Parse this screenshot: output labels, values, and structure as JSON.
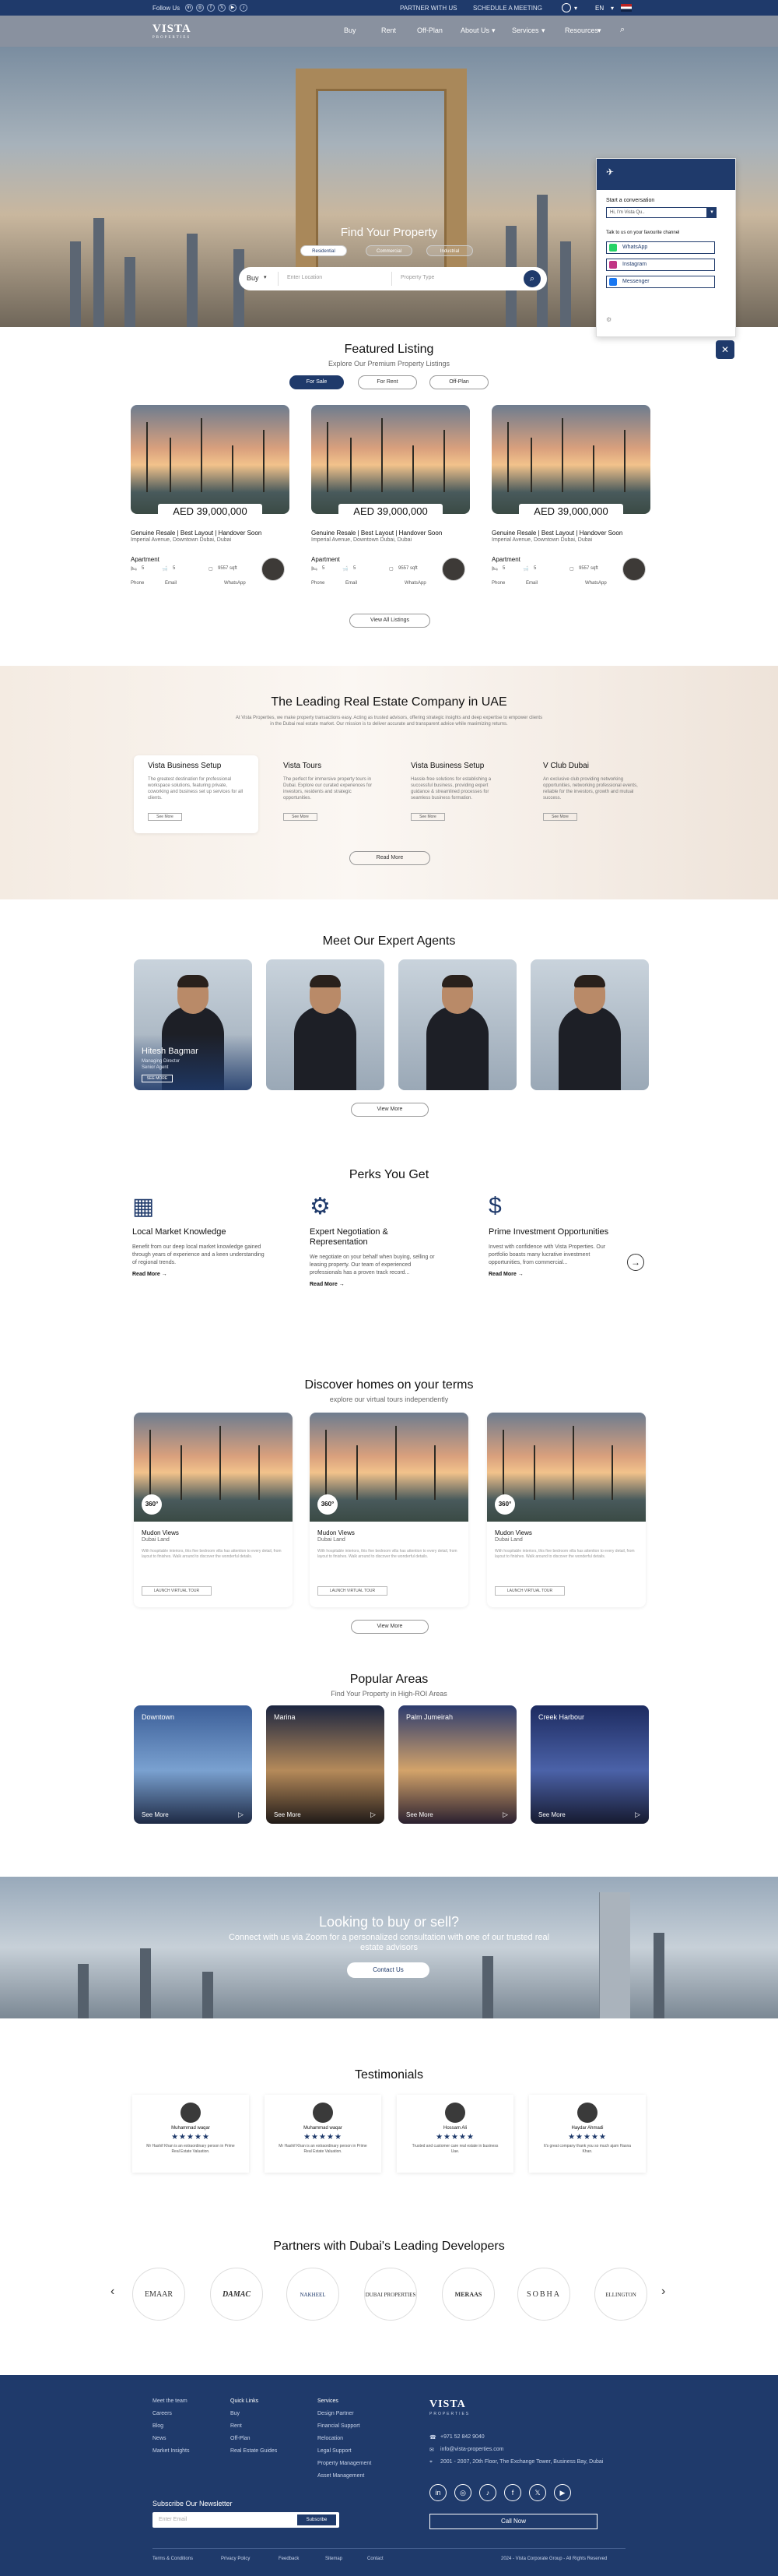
{
  "topbar": {
    "follow": "Follow Us",
    "social": [
      "in",
      "◎",
      "f",
      "𝕏",
      "▶",
      "♪"
    ],
    "partner": "PARTNER WITH US",
    "schedule": "SCHEDULE A MEETING",
    "lang": "EN"
  },
  "nav": {
    "logo": "VISTA",
    "logo_sub": "PROPERTIES",
    "items": [
      "Buy",
      "Rent",
      "Off-Plan",
      "About Us",
      "Services",
      "Resources"
    ]
  },
  "hero": {
    "title": "Find Your Property",
    "tabs": [
      "Residential",
      "Commercial",
      "Industrial"
    ],
    "search": {
      "mode": "Buy",
      "location_placeholder": "Enter Location",
      "type_placeholder": "Property Type"
    }
  },
  "chat": {
    "title": "Start a conversation",
    "select": "Hi, I'm Vista Qu..",
    "prompt": "Talk to us on your favourite channel",
    "channels": [
      "WhatsApp",
      "Instagram",
      "Messenger"
    ]
  },
  "featured": {
    "title": "Featured Listing",
    "subtitle": "Explore Our Premium Property Listings",
    "tabs": [
      "For Sale",
      "For Rent",
      "Off-Plan"
    ],
    "cards": [
      {
        "price": "AED 39,000,000",
        "title": "Genuine Resale | Best Layout | Handover Soon",
        "address": "Imperial Avenue, Downtown Dubai, Dubai",
        "kind": "Apartment",
        "beds": "5",
        "baths": "5",
        "area": "9557 sqft"
      },
      {
        "price": "AED 39,000,000",
        "title": "Genuine Resale | Best Layout | Handover Soon",
        "address": "Imperial Avenue, Downtown Dubai, Dubai",
        "kind": "Apartment",
        "beds": "5",
        "baths": "5",
        "area": "9557 sqft"
      },
      {
        "price": "AED 39,000,000",
        "title": "Genuine Resale | Best Layout | Handover Soon",
        "address": "Imperial Avenue, Downtown Dubai, Dubai",
        "kind": "Apartment",
        "beds": "5",
        "baths": "5",
        "area": "9557 sqft"
      }
    ],
    "contacts": [
      "Phone",
      "Email",
      "WhatsApp"
    ],
    "view_all": "View All Listings"
  },
  "about": {
    "title": "The Leading Real Estate Company in UAE",
    "intro": "At Vista Properties, we make property transactions easy. Acting as trusted advisors, offering strategic insights and deep expertise to empower clients in the Dubai real estate market. Our mission is to deliver accurate and transparent advice while maximizing returns.",
    "boxes": [
      {
        "title": "Vista Business Setup",
        "text": "The greatest destination for professional workspace solutions, featuring private, coworking and business set up services for all clients.",
        "btn": "See More"
      },
      {
        "title": "Vista Tours",
        "text": "The perfect for immersive property tours in Dubai. Explore our curated experiences for investors, residents and strategic opportunities.",
        "btn": "See More"
      },
      {
        "title": "Vista Business Setup",
        "text": "Hassle-free solutions for establishing a successful business, providing expert guidance & streamlined processes for seamless business formation.",
        "btn": "See More"
      },
      {
        "title": "V Club Dubai",
        "text": "An exclusive club providing networking opportunities, networking professional events, reliable for the investors, growth and mutual success.",
        "btn": "See More"
      }
    ],
    "read_more": "Read More"
  },
  "agents": {
    "title": "Meet Our Expert Agents",
    "featured_name": "Hitesh Bagmar",
    "featured_role": "Managing Director",
    "featured_role2": "Senior Agent",
    "featured_btn": "SEE MORE",
    "view_more": "View More"
  },
  "perks": {
    "title": "Perks You Get",
    "items": [
      {
        "title": "Local Market Knowledge",
        "text": "Benefit from our deep local market knowledge gained through years of experience and a keen understanding of regional trends.",
        "link": "Read More →"
      },
      {
        "title": "Expert Negotiation & Representation",
        "text": "We negotiate on your behalf when buying, selling or leasing property. Our team of experienced professionals has a proven track record...",
        "link": "Read More →"
      },
      {
        "title": "Prime Investment Opportunities",
        "text": "Invest with confidence with Vista Properties. Our portfolio boasts many lucrative investment opportunities, from commercial...",
        "link": "Read More →"
      }
    ]
  },
  "discover": {
    "title": "Discover homes on your terms",
    "subtitle": "explore our virtual tours independently",
    "cards": [
      {
        "badge": "360°",
        "title": "Mudon Views",
        "area": "Dubai Land",
        "desc": "With hospitable interiors, this five bedroom villa has attention to every detail, from layout to finishes. Walk around to discover the wonderful details.",
        "btn": "LAUNCH VIRTUAL TOUR"
      },
      {
        "badge": "360°",
        "title": "Mudon Views",
        "area": "Dubai Land",
        "desc": "With hospitable interiors, this five bedroom villa has attention to every detail, from layout to finishes. Walk around to discover the wonderful details.",
        "btn": "LAUNCH VIRTUAL TOUR"
      },
      {
        "badge": "360°",
        "title": "Mudon Views",
        "area": "Dubai Land",
        "desc": "With hospitable interiors, this five bedroom villa has attention to every detail, from layout to finishes. Walk around to discover the wonderful details.",
        "btn": "LAUNCH VIRTUAL TOUR"
      }
    ],
    "view_more": "View More"
  },
  "areas": {
    "title": "Popular Areas",
    "subtitle": "Find Your Property in High-ROI Areas",
    "items": [
      {
        "name": "Downtown",
        "more": "See More"
      },
      {
        "name": "Marina",
        "more": "See More"
      },
      {
        "name": "Palm Jumeirah",
        "more": "See More"
      },
      {
        "name": "Creek Harbour",
        "more": "See More"
      }
    ]
  },
  "cta": {
    "title": "Looking to buy or sell?",
    "text": "Connect with us via Zoom for a personalized consultation with one of our trusted real estate advisors",
    "btn": "Contact Us"
  },
  "testimonials": {
    "title": "Testimonials",
    "items": [
      {
        "name": "Muhammad waqar",
        "stars": "★★★★★",
        "text": "Mr Hashif Khan is an extraordinary person in Prime Real Estate Valuation."
      },
      {
        "name": "Muhammad waqar",
        "stars": "★★★★★",
        "text": "Mr Hashif Khan is an extraordinary person in Prime Real Estate Valuation."
      },
      {
        "name": "Hossam Ali",
        "stars": "★★★★★",
        "text": "Trusted and customer care real estate in business Uae."
      },
      {
        "name": "Haydar Ahmadi",
        "stars": "★★★★★",
        "text": "It's great company thank you so much ajam Hasna Khan."
      }
    ]
  },
  "partners": {
    "title": "Partners with Dubai's Leading Developers",
    "logos": [
      "EMAAR",
      "DAMAC",
      "NAKHEEL",
      "DUBAI PROPERTIES",
      "MERAAS",
      "SOBHA",
      "ELLINGTON"
    ]
  },
  "footer": {
    "col1": [
      "Meet the team",
      "Careers",
      "Blog",
      "News",
      "Market Insights"
    ],
    "col2": [
      "Quick Links",
      "Buy",
      "Rent",
      "Off-Plan",
      "Real Estate Guides"
    ],
    "col3": [
      "Services",
      "Design Partner",
      "Financial Support",
      "Relocation",
      "Legal Support",
      "Property Management",
      "Asset Management"
    ],
    "phone": "+971 52 842 9040",
    "email": "info@vista-properties.com",
    "address": "2001 - 2007, 20th Floor, The Exchange Tower, Business Bay, Dubai",
    "call_btn": "Call Now",
    "newsletter_title": "Subscribe Our Newsletter",
    "newsletter_placeholder": "Enter Email",
    "subscribe": "Subscribe",
    "bottom_links": [
      "Terms & Conditions",
      "Privacy Policy",
      "Feedback",
      "Sitemap",
      "Contact"
    ],
    "copyright": "2024 - Vista Corporate Group - All Rights Reserved"
  },
  "colors": {
    "brand": "#1f3a6b",
    "accent": "#c0956a"
  }
}
